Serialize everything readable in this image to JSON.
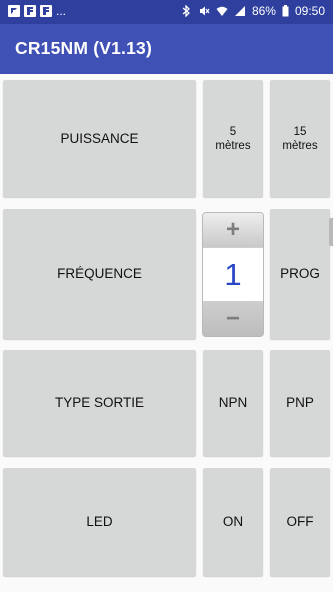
{
  "statusbar": {
    "left_dots": "...",
    "battery_text": "86%",
    "time": "09:50",
    "icons": [
      "app-notification-icon",
      "f-notification-icon",
      "f-notification-icon",
      "bluetooth-icon",
      "mute-icon",
      "wifi-icon",
      "signal-icon",
      "battery-icon"
    ]
  },
  "appbar": {
    "title": "CR15NM (V1.13)"
  },
  "rows": {
    "puissance": {
      "label": "PUISSANCE",
      "option1": "5\nmètres",
      "option2": "15\nmètres"
    },
    "frequence": {
      "label": "FRÉQUENCE",
      "prog": "PROG"
    },
    "type_sortie": {
      "label": "TYPE SORTIE",
      "option1": "NPN",
      "option2": "PNP"
    },
    "led": {
      "label": "LED",
      "on": "ON",
      "off": "OFF"
    }
  },
  "picker": {
    "plus": "+",
    "value": "1",
    "minus": "−"
  },
  "colors": {
    "statusbar": "#2e3f9e",
    "appbar": "#3f51b5",
    "button": "#d6d7d7",
    "picker_value": "#2a46c8"
  }
}
